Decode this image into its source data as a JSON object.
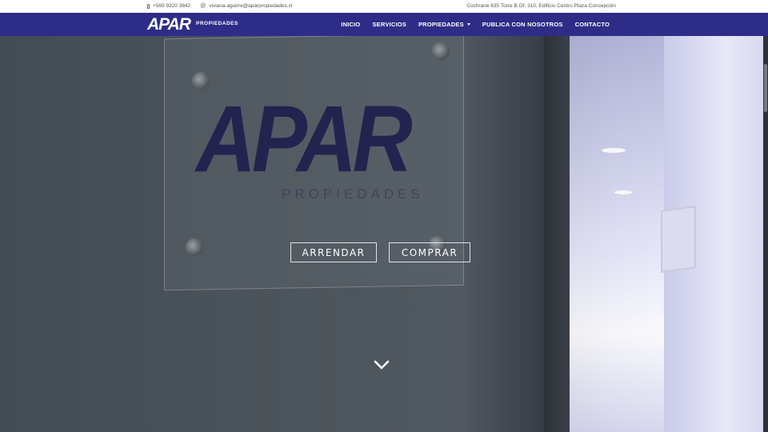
{
  "topbar": {
    "phone": "+569 9320 3842",
    "email": "viviana.aguirre@aparpropiedades.cl",
    "address": "Cochrane 635 Torre B Of. 310, Edificio Centro Plaza Concepción"
  },
  "navbar": {
    "logo": "APAR",
    "logo_sub": "PROPIEDADES",
    "menu": [
      {
        "label": "INICIO"
      },
      {
        "label": "SERVICIOS"
      },
      {
        "label": "PROPIEDADES"
      },
      {
        "label": "PUBLICA CON NOSOTROS"
      },
      {
        "label": "CONTACTO"
      }
    ]
  },
  "hero": {
    "sign_logo": "APAR",
    "sign_sub": "PROPIEDADES",
    "buttons": {
      "arrendar": "ARRENDAR",
      "comprar": "COMPRAR"
    },
    "scroll_icon": "chevron-down-icon"
  },
  "colors": {
    "nav_bg": "#2d2d88",
    "topbar_bg": "#ffffff",
    "button_border": "#e0e0ea"
  }
}
